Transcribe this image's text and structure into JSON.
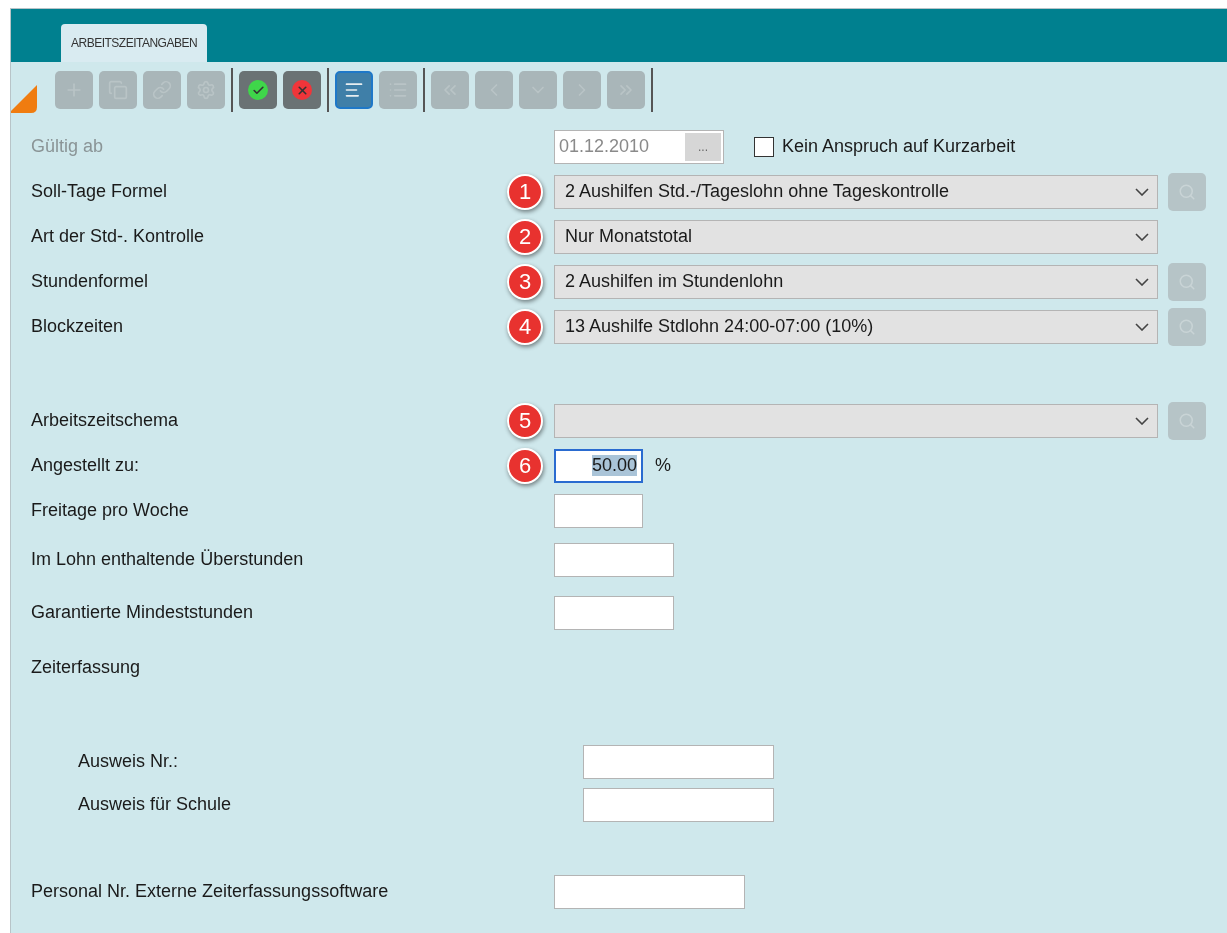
{
  "tab": {
    "label": "ARBEITSZEITANGABEN",
    "selected": true
  },
  "toolbar": [
    [
      {
        "kind": "add",
        "disabled": true
      },
      {
        "kind": "copy",
        "disabled": true
      },
      {
        "kind": "link",
        "disabled": true
      },
      {
        "kind": "settings",
        "disabled": true
      }
    ],
    [
      {
        "kind": "confirm",
        "disabled": false
      },
      {
        "kind": "cancel",
        "disabled": false
      }
    ],
    [
      {
        "kind": "detail",
        "disabled": false,
        "selected": true
      },
      {
        "kind": "list",
        "disabled": true,
        "selected": false
      }
    ],
    [
      {
        "kind": "first",
        "disabled": true
      },
      {
        "kind": "previous",
        "disabled": true
      },
      {
        "kind": "down",
        "disabled": true
      },
      {
        "kind": "next",
        "disabled": true
      },
      {
        "kind": "last",
        "disabled": true
      }
    ]
  ],
  "sections": [
    {
      "indented": false,
      "rows": [
        {
          "kind": "date",
          "label": "Gültig ab",
          "disabled": true,
          "value": "01.12.2010",
          "button": "...",
          "checkbox": {
            "label": "Kein Anspruch auf Kurzarbeit",
            "checked": false
          }
        },
        {
          "kind": "select",
          "label": "Soll-Tage Formel",
          "badge": "1",
          "value": "2 Aushilfen Std.-/Tageslohn ohne Tageskontrolle",
          "lookup": true
        },
        {
          "kind": "select",
          "label": "Art der Std-. Kontrolle",
          "badge": "2",
          "value": "Nur Monatstotal",
          "lookup": false
        },
        {
          "kind": "select",
          "label": "Stundenformel",
          "badge": "3",
          "value": "2 Aushilfen im Stundenlohn",
          "lookup": true
        },
        {
          "kind": "select",
          "label": "Blockzeiten",
          "badge": "4",
          "value": "13 Aushilfe Stdlohn 24:00-07:00 (10%)",
          "lookup": true
        }
      ]
    },
    {
      "indented": false,
      "rows": [
        {
          "kind": "select",
          "label": "Arbeitszeitschema",
          "badge": "5",
          "lookup": true
        },
        {
          "kind": "number",
          "label": "Angestellt zu:",
          "badge": "6",
          "value": "50.00",
          "unit": "%",
          "focused": true
        },
        {
          "kind": "number",
          "label": "Freitage pro Woche",
          "focused": false
        },
        {
          "kind": "text",
          "label": "Im Lohn enthaltende Überstunden"
        },
        {
          "kind": "text",
          "label": "Garantierte Mindeststunden"
        },
        {
          "kind": "heading",
          "label": "Zeiterfassung"
        }
      ]
    },
    {
      "indented": true,
      "rows": [
        {
          "kind": "wide",
          "label": "Ausweis Nr.:"
        },
        {
          "kind": "wide",
          "label": "Ausweis für Schule"
        }
      ]
    },
    {
      "indented": false,
      "rows": [
        {
          "kind": "wide",
          "label": "Personal Nr. Externe Zeiterfassungssoftware"
        }
      ]
    }
  ]
}
